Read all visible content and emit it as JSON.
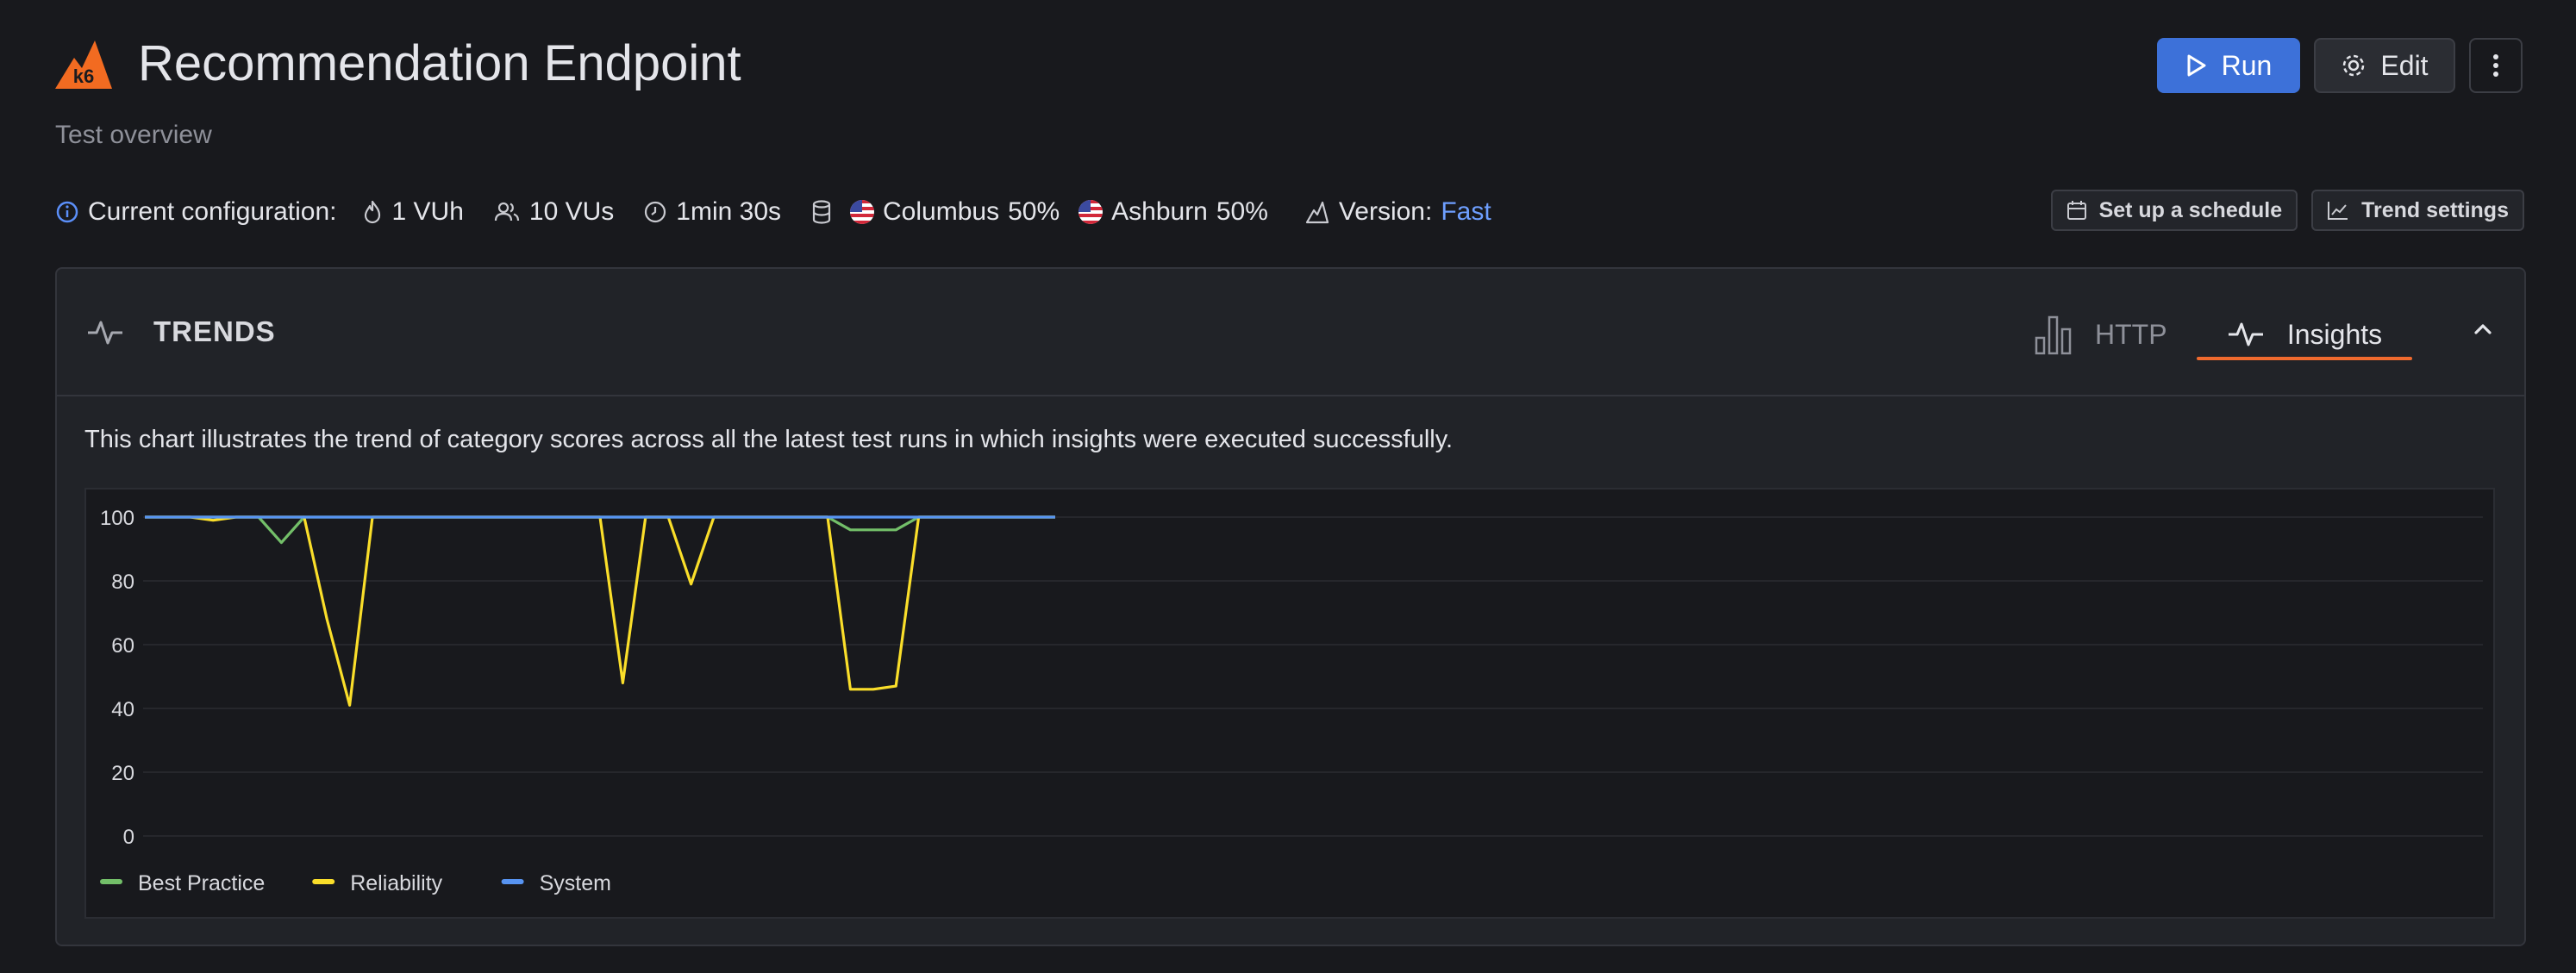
{
  "header": {
    "logo_text": "k6",
    "title": "Recommendation Endpoint",
    "subtitle": "Test overview"
  },
  "actions": {
    "run_label": "Run",
    "edit_label": "Edit"
  },
  "config": {
    "label": "Current configuration:",
    "vuh": "1 VUh",
    "vus": "10 VUs",
    "duration": "1min 30s",
    "locations": [
      {
        "name": "Columbus",
        "share": "50%"
      },
      {
        "name": "Ashburn",
        "share": "50%"
      }
    ],
    "version_label": "Version:",
    "version_value": "Fast"
  },
  "right_actions": {
    "schedule_label": "Set up a schedule",
    "trend_settings_label": "Trend settings"
  },
  "panel": {
    "title": "TRENDS",
    "tabs": [
      {
        "label": "HTTP",
        "active": false
      },
      {
        "label": "Insights",
        "active": true
      }
    ],
    "description": "This chart illustrates the trend of category scores across all the latest test runs in which insights were executed successfully."
  },
  "colors": {
    "accent": "#3d71d9",
    "tab_underline": "#f06a2e",
    "link": "#6e9fff",
    "best_practice": "#73bf69",
    "reliability": "#fade2a",
    "system": "#5794f2"
  },
  "chart_data": {
    "type": "line",
    "title": "",
    "xlabel": "",
    "ylabel": "",
    "ylim": [
      0,
      100
    ],
    "yticks": [
      0,
      20,
      40,
      60,
      80,
      100
    ],
    "grid": true,
    "legend": "bottom-left",
    "x": [
      0,
      1,
      2,
      3,
      4,
      5,
      6,
      7,
      8,
      9,
      10,
      11,
      12,
      13,
      14,
      15,
      16,
      17,
      18,
      19,
      20,
      21,
      22,
      23,
      24,
      25,
      26,
      27,
      28,
      29,
      30,
      31,
      32,
      33,
      34,
      35,
      36,
      37,
      38,
      39,
      40
    ],
    "series": [
      {
        "name": "Best Practice",
        "color": "#73bf69",
        "values": [
          100,
          100,
          100,
          100,
          100,
          100,
          92,
          100,
          100,
          100,
          100,
          100,
          100,
          100,
          100,
          100,
          100,
          100,
          100,
          100,
          100,
          100,
          100,
          100,
          100,
          100,
          100,
          100,
          100,
          100,
          100,
          96,
          96,
          96,
          100,
          100,
          100,
          100,
          100,
          100,
          100
        ]
      },
      {
        "name": "Reliability",
        "color": "#fade2a",
        "values": [
          100,
          100,
          100,
          99,
          100,
          100,
          100,
          100,
          68,
          41,
          100,
          100,
          100,
          100,
          100,
          100,
          100,
          100,
          100,
          100,
          100,
          48,
          100,
          100,
          79,
          100,
          100,
          100,
          100,
          100,
          100,
          46,
          46,
          47,
          100,
          100,
          100,
          100,
          100,
          100,
          100
        ]
      },
      {
        "name": "System",
        "color": "#5794f2",
        "values": [
          100,
          100,
          100,
          100,
          100,
          100,
          100,
          100,
          100,
          100,
          100,
          100,
          100,
          100,
          100,
          100,
          100,
          100,
          100,
          100,
          100,
          100,
          100,
          100,
          100,
          100,
          100,
          100,
          100,
          100,
          100,
          100,
          100,
          100,
          100,
          100,
          100,
          100,
          100,
          100,
          100
        ]
      }
    ]
  }
}
